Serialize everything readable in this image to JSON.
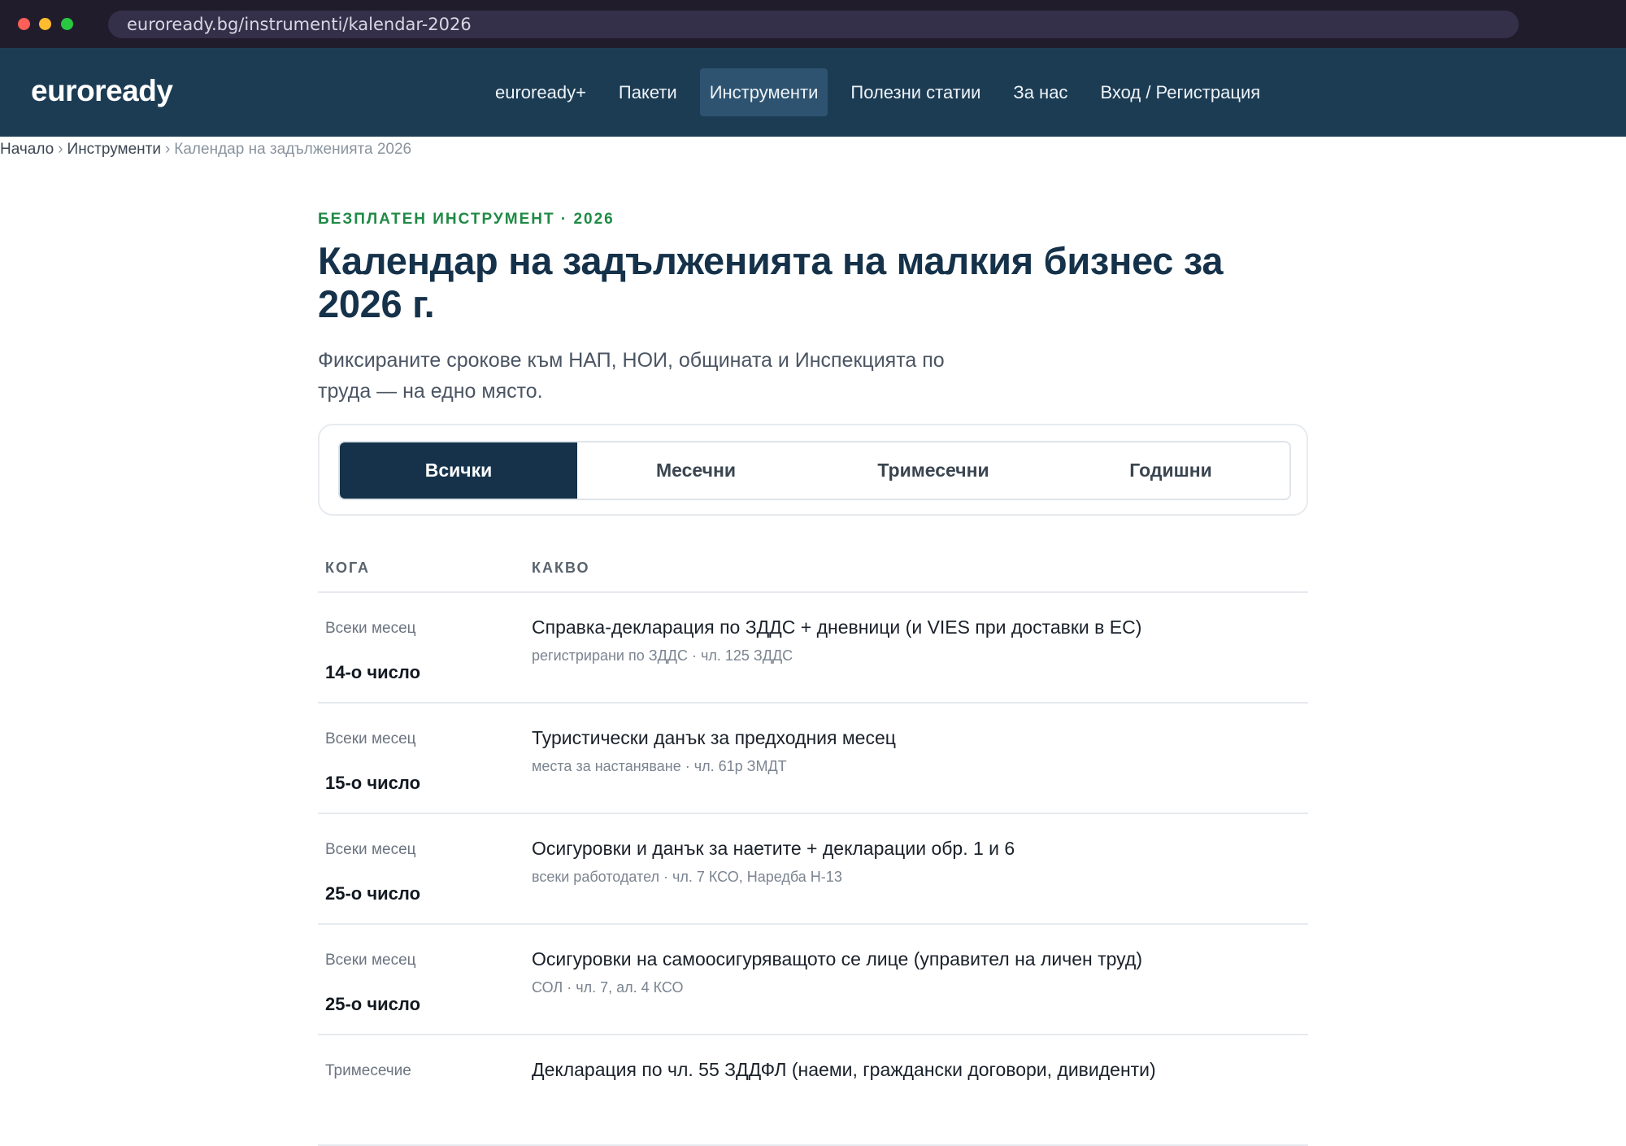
{
  "browser": {
    "url": "euroready.bg/instrumenti/kalendar-2026"
  },
  "nav": {
    "logo": "euroready",
    "items": [
      {
        "label": "euroready+"
      },
      {
        "label": "Пакети"
      },
      {
        "label": "Инструменти"
      },
      {
        "label": "Полезни статии"
      },
      {
        "label": "За нас"
      },
      {
        "label": "Вход / Регистрация"
      }
    ],
    "active": "Инструменти"
  },
  "breadcrumb": {
    "home": "Начало",
    "section": "Инструменти",
    "current": "Календар на задълженията 2026",
    "separator": "›"
  },
  "hero": {
    "kicker": "БЕЗПЛАТЕН ИНСТРУМЕНТ · 2026",
    "title": "Календар на задълженията на малкия бизнес за 2026 г.",
    "subtitle": "Фиксираните срокове към НАП, НОИ, общината и Инспекцията по труда — на едно място."
  },
  "filters": {
    "tabs": [
      {
        "label": "Всички"
      },
      {
        "label": "Месечни"
      },
      {
        "label": "Тримесечни"
      },
      {
        "label": "Годишни"
      }
    ],
    "selected": "Всички"
  },
  "table": {
    "headers": {
      "when": "КОГА",
      "what": "КАКВО"
    },
    "rows": [
      {
        "freq": "Всеки месец",
        "date": "14-о число",
        "task": "Справка-декларация по ЗДДС + дневници (и VIES при доставки в ЕС)",
        "note": "регистрирани по ЗДДС · чл. 125 ЗДДС"
      },
      {
        "freq": "Всеки месец",
        "date": "15-о число",
        "task": "Туристически данък за предходния месец",
        "note": "места за настаняване · чл. 61р ЗМДТ"
      },
      {
        "freq": "Всеки месец",
        "date": "25-о число",
        "task": "Осигуровки и данък за наетите + декларации обр. 1 и 6",
        "note": "всеки работодател · чл. 7 КСО, Наредба Н-13"
      },
      {
        "freq": "Всеки месец",
        "date": "25-о число",
        "task": "Осигуровки на самоосигуряващото се лице (управител на личен труд)",
        "note": "СОЛ · чл. 7, ал. 4 КСО"
      },
      {
        "freq": "Тримесечие",
        "date": "",
        "task": "Декларация по чл. 55 ЗДДФЛ (наеми, граждански договори, дивиденти)",
        "note": ""
      }
    ]
  }
}
